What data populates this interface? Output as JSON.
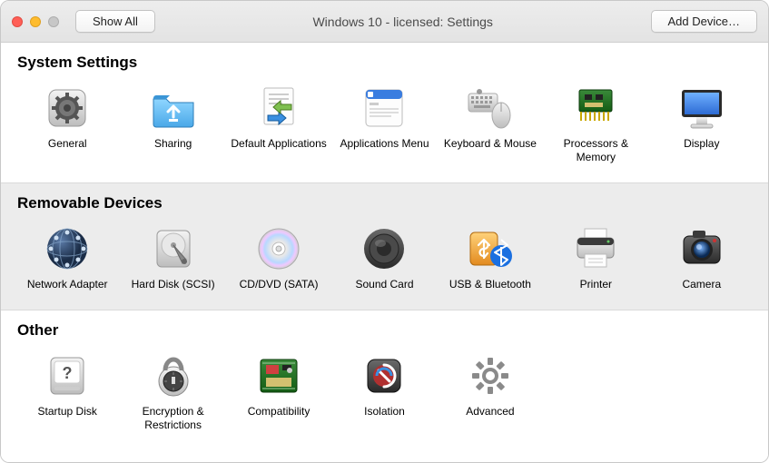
{
  "titlebar": {
    "show_all_label": "Show All",
    "title": "Windows 10  - licensed: Settings",
    "add_device_label": "Add Device…"
  },
  "sections": [
    {
      "title": "System Settings",
      "alt": false,
      "items": [
        {
          "icon": "general-icon",
          "label": "General"
        },
        {
          "icon": "sharing-icon",
          "label": "Sharing"
        },
        {
          "icon": "default-apps-icon",
          "label": "Default Applications"
        },
        {
          "icon": "apps-menu-icon",
          "label": "Applications Menu"
        },
        {
          "icon": "keyboard-mouse-icon",
          "label": "Keyboard & Mouse"
        },
        {
          "icon": "cpu-memory-icon",
          "label": "Processors & Memory"
        },
        {
          "icon": "display-icon",
          "label": "Display"
        }
      ]
    },
    {
      "title": "Removable Devices",
      "alt": true,
      "items": [
        {
          "icon": "network-adapter-icon",
          "label": "Network Adapter"
        },
        {
          "icon": "hard-disk-icon",
          "label": "Hard Disk (SCSI)"
        },
        {
          "icon": "optical-disc-icon",
          "label": "CD/DVD (SATA)"
        },
        {
          "icon": "sound-card-icon",
          "label": "Sound Card"
        },
        {
          "icon": "usb-bluetooth-icon",
          "label": "USB & Bluetooth"
        },
        {
          "icon": "printer-icon",
          "label": "Printer"
        },
        {
          "icon": "camera-icon",
          "label": "Camera"
        }
      ]
    },
    {
      "title": "Other",
      "alt": false,
      "items": [
        {
          "icon": "startup-disk-icon",
          "label": "Startup Disk"
        },
        {
          "icon": "encryption-icon",
          "label": "Encryption & Restrictions"
        },
        {
          "icon": "compatibility-icon",
          "label": "Compatibility"
        },
        {
          "icon": "isolation-icon",
          "label": "Isolation"
        },
        {
          "icon": "advanced-icon",
          "label": "Advanced"
        }
      ]
    }
  ]
}
